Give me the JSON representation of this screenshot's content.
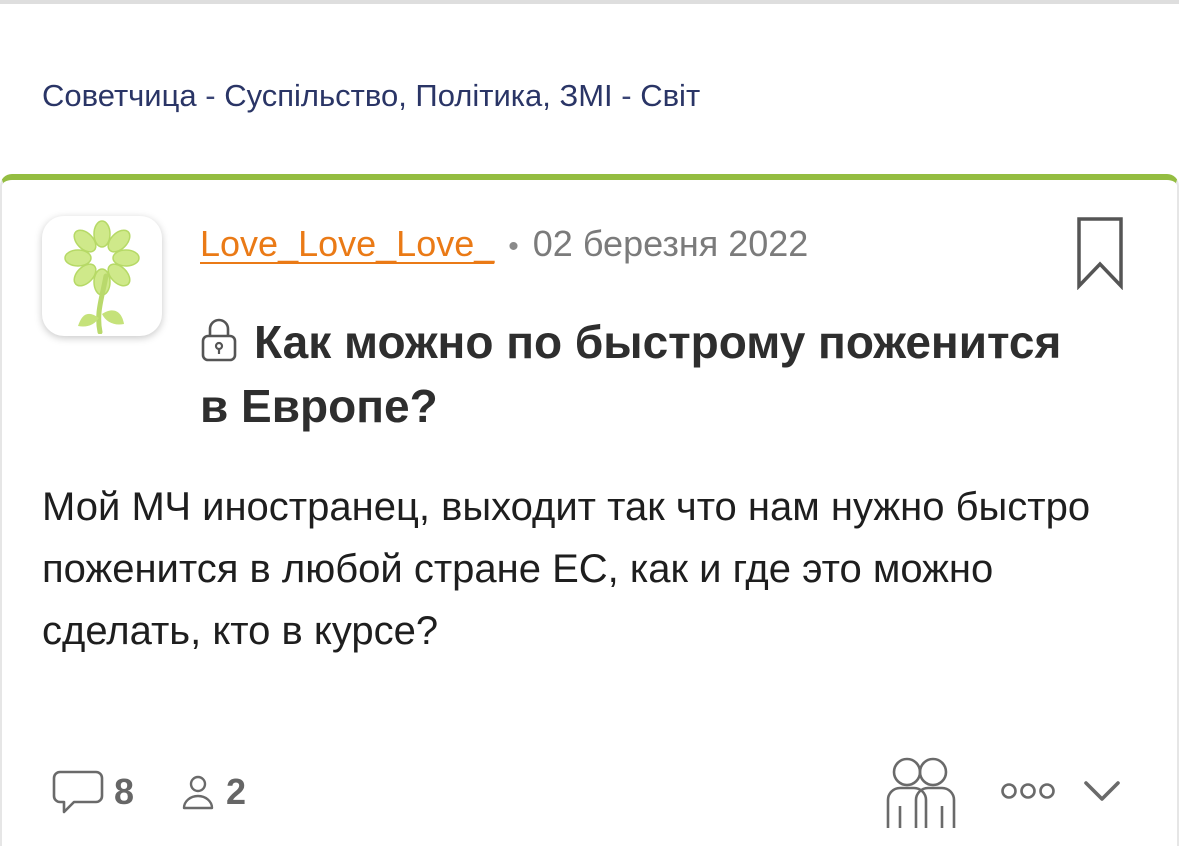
{
  "breadcrumb": {
    "site": "Советчица",
    "separator": " - ",
    "section": "Суспільство, Політика, ЗМІ",
    "subsection": "Світ"
  },
  "post": {
    "author": "Love_Love_Love_",
    "meta_dot": "•",
    "date": "02 березня 2022",
    "title": "Как можно по быстрому поженится в Европе?",
    "body": "Мой МЧ иностранец, выходит так что нам нужно быстро поженится в любой стране ЕС, как и где это можно сделать, кто в курсе?"
  },
  "footer": {
    "comments_count": "8",
    "participants_count": "2"
  },
  "colors": {
    "accent_green": "#94bd41",
    "author_orange": "#ea7a16",
    "breadcrumb_navy": "#2a3566"
  },
  "icons": {
    "avatar": "flower-logo-icon",
    "bookmark": "bookmark-icon",
    "lock": "lock-icon",
    "comments": "comment-bubble-icon",
    "participants": "person-icon",
    "people": "people-group-icon",
    "more": "more-dots-icon",
    "expand": "chevron-down-icon"
  }
}
